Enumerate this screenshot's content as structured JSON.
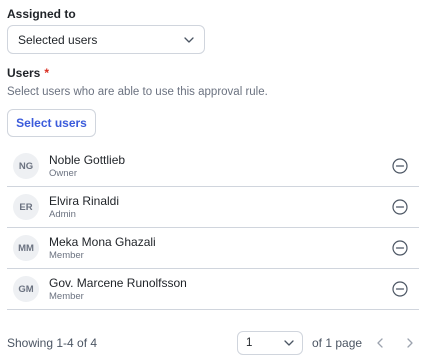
{
  "assigned": {
    "label": "Assigned to",
    "selected": "Selected users"
  },
  "users": {
    "label": "Users",
    "required_mark": "*",
    "help": "Select users who are able to use this approval rule.",
    "select_button": "Select users",
    "list": [
      {
        "initials": "NG",
        "name": "Noble Gottlieb",
        "role": "Owner"
      },
      {
        "initials": "ER",
        "name": "Elvira Rinaldi",
        "role": "Admin"
      },
      {
        "initials": "MM",
        "name": "Meka Mona Ghazali",
        "role": "Member"
      },
      {
        "initials": "GM",
        "name": "Gov. Marcene Runolfsson",
        "role": "Member"
      }
    ]
  },
  "pagination": {
    "showing": "Showing 1-4 of 4",
    "page_value": "1",
    "of_pages": "of 1 page"
  },
  "colors": {
    "accent": "#3b5bdb",
    "required": "#d92d20",
    "border": "#d0d5dd",
    "muted": "#6b7280"
  },
  "icons": {
    "dropdown": "chevron-down-icon",
    "remove": "minus-circle-icon",
    "prev": "chevron-left-icon",
    "next": "chevron-right-icon"
  }
}
